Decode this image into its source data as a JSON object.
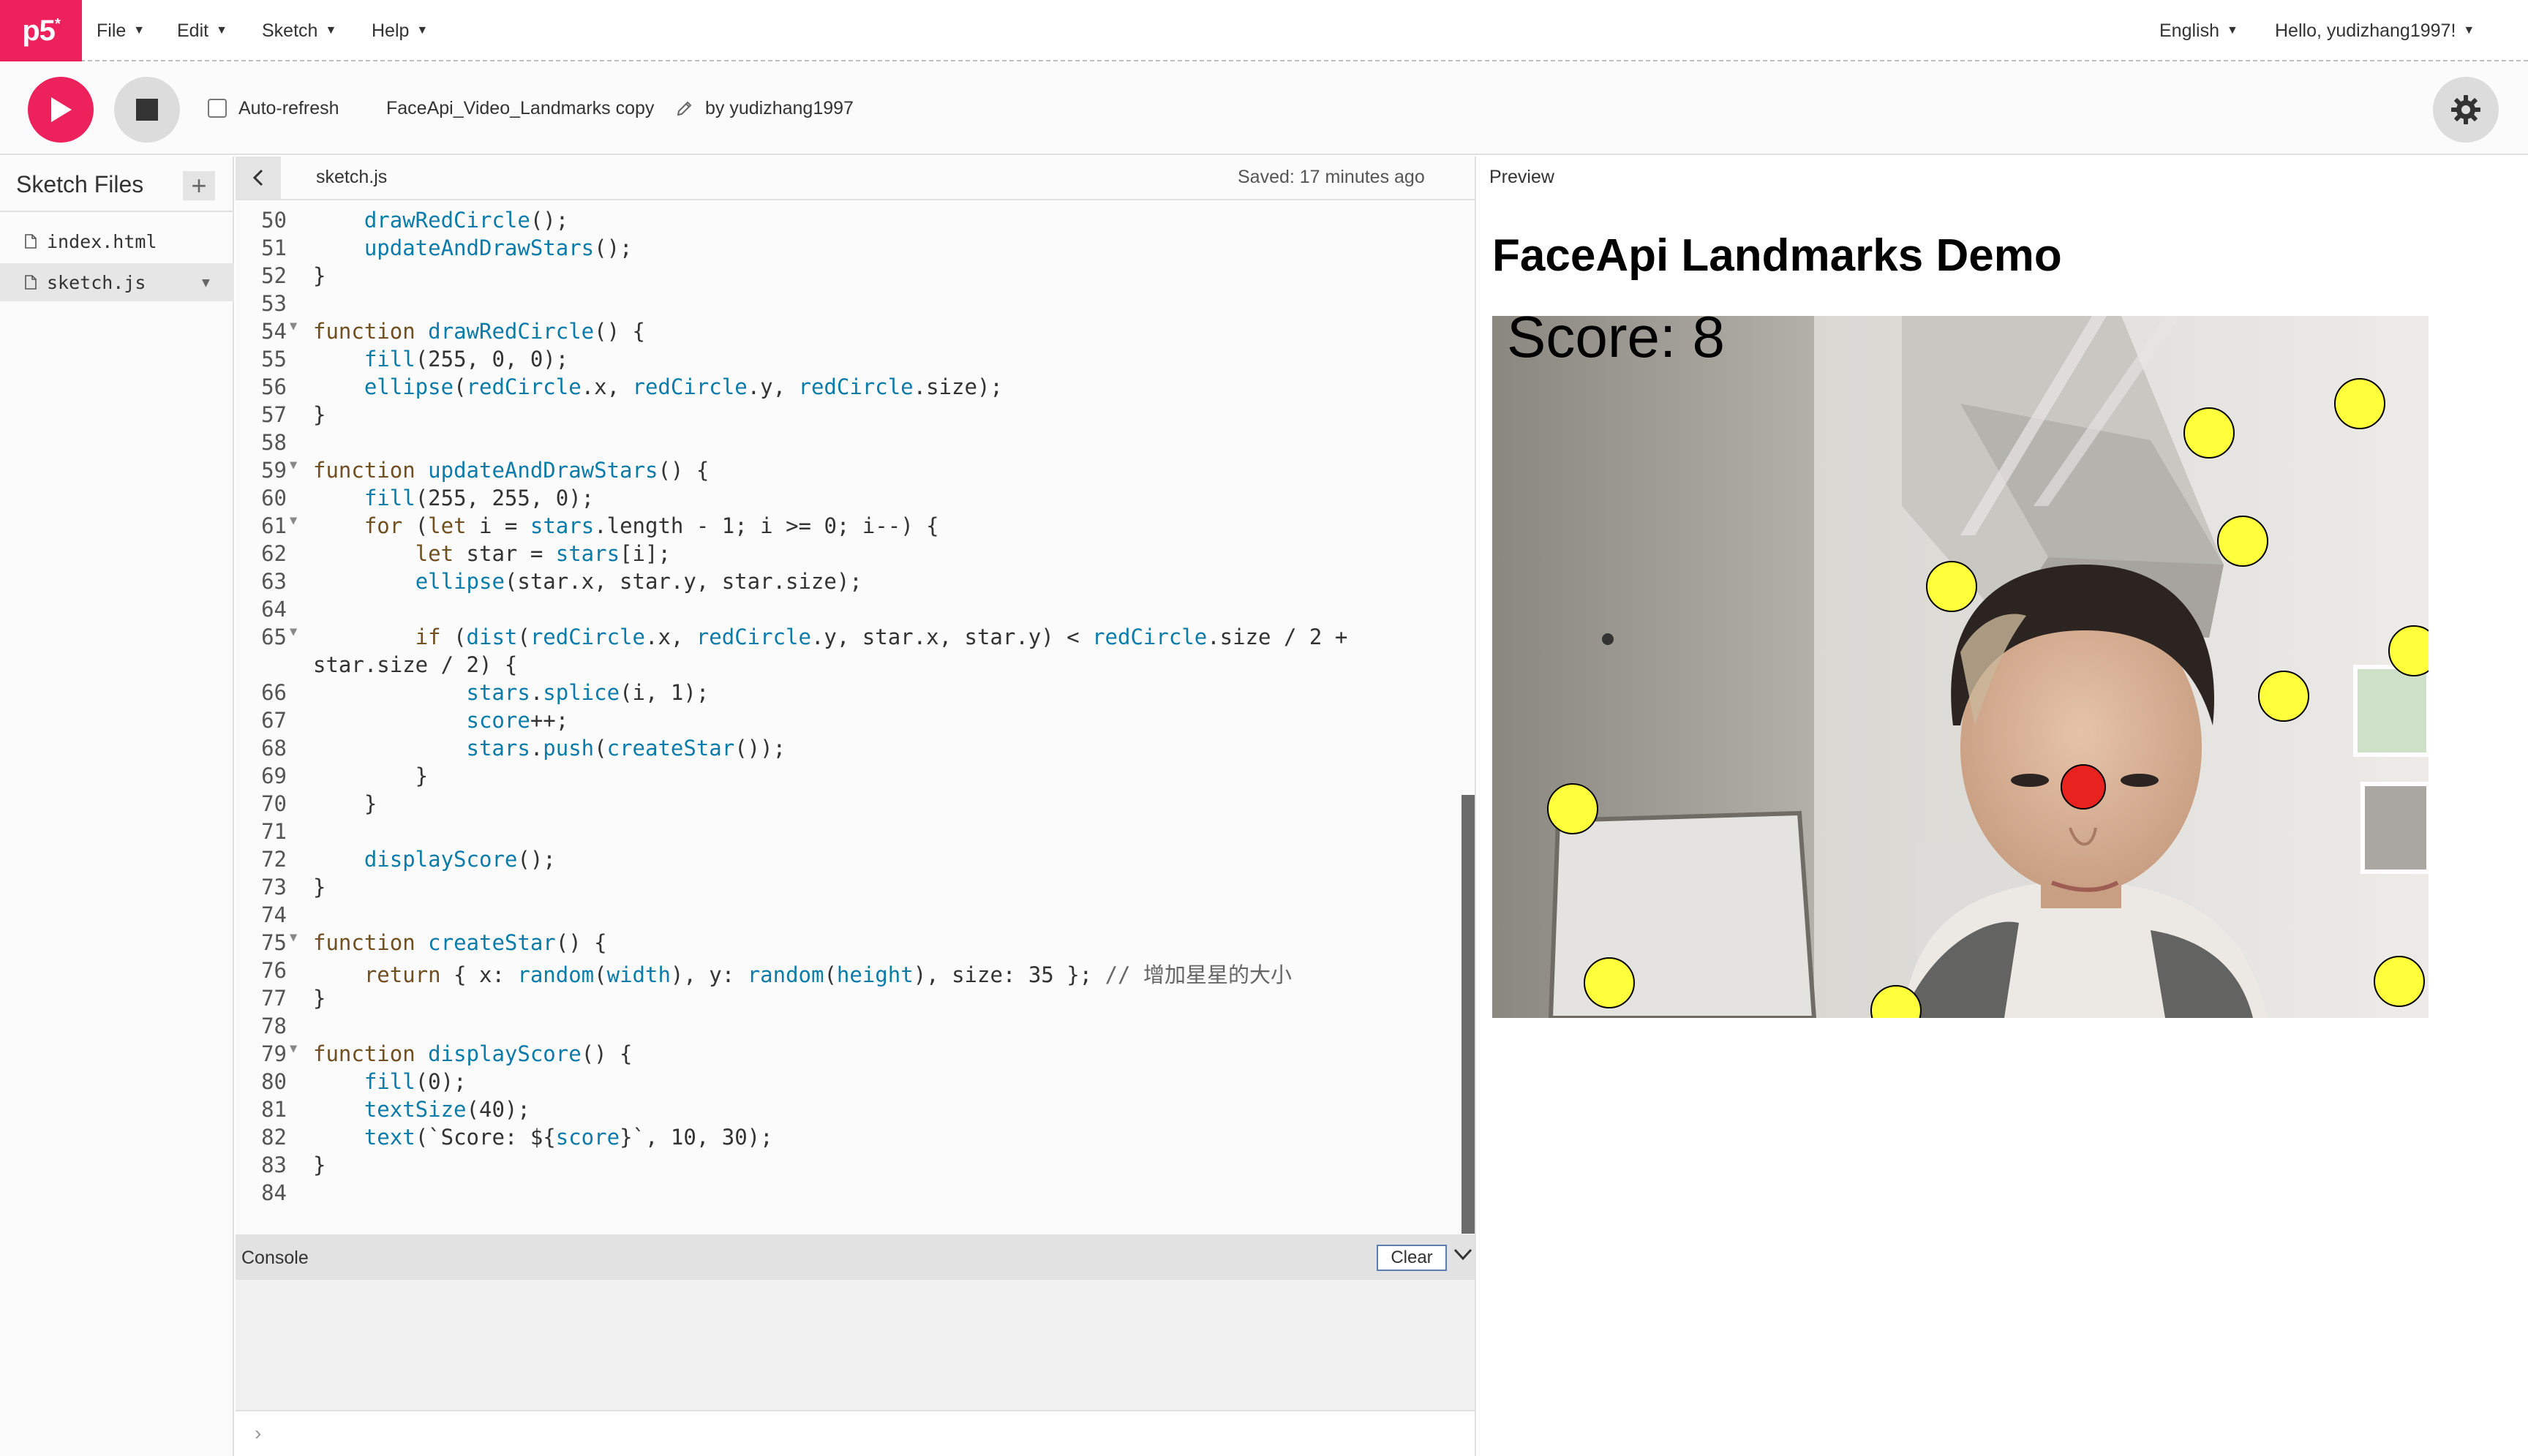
{
  "nav": {
    "logo": "p5",
    "menus": [
      "File",
      "Edit",
      "Sketch",
      "Help"
    ],
    "language": "English",
    "greeting": "Hello, yudizhang1997!"
  },
  "toolbar": {
    "auto_refresh_label": "Auto-refresh",
    "auto_refresh_checked": false,
    "sketch_name": "FaceApi_Video_Landmarks copy",
    "by_label": "by yudizhang1997"
  },
  "sidebar": {
    "title": "Sketch Files",
    "files": [
      "index.html",
      "sketch.js"
    ],
    "selected": "sketch.js"
  },
  "editor": {
    "tab_name": "sketch.js",
    "saved_status": "Saved: 17 minutes ago",
    "lines": [
      {
        "n": "50",
        "text": "    drawRedCircle();",
        "fold": false
      },
      {
        "n": "51",
        "text": "    updateAndDrawStars();",
        "fold": false
      },
      {
        "n": "52",
        "text": "}",
        "fold": false
      },
      {
        "n": "53",
        "text": "",
        "fold": false
      },
      {
        "n": "54",
        "text": "function drawRedCircle() {",
        "fold": true
      },
      {
        "n": "55",
        "text": "    fill(255, 0, 0);",
        "fold": false
      },
      {
        "n": "56",
        "text": "    ellipse(redCircle.x, redCircle.y, redCircle.size);",
        "fold": false
      },
      {
        "n": "57",
        "text": "}",
        "fold": false
      },
      {
        "n": "58",
        "text": "",
        "fold": false
      },
      {
        "n": "59",
        "text": "function updateAndDrawStars() {",
        "fold": true
      },
      {
        "n": "60",
        "text": "    fill(255, 255, 0);",
        "fold": false
      },
      {
        "n": "61",
        "text": "    for (let i = stars.length - 1; i >= 0; i--) {",
        "fold": true
      },
      {
        "n": "62",
        "text": "        let star = stars[i];",
        "fold": false
      },
      {
        "n": "63",
        "text": "        ellipse(star.x, star.y, star.size);",
        "fold": false
      },
      {
        "n": "64",
        "text": "",
        "fold": false
      },
      {
        "n": "65",
        "text": "        if (dist(redCircle.x, redCircle.y, star.x, star.y) < redCircle.size / 2 +",
        "wrap": "star.size / 2) {",
        "fold": true
      },
      {
        "n": "66",
        "text": "            stars.splice(i, 1);",
        "fold": false
      },
      {
        "n": "67",
        "text": "            score++;",
        "fold": false
      },
      {
        "n": "68",
        "text": "            stars.push(createStar());",
        "fold": false
      },
      {
        "n": "69",
        "text": "        }",
        "fold": false
      },
      {
        "n": "70",
        "text": "    }",
        "fold": false
      },
      {
        "n": "71",
        "text": "",
        "fold": false
      },
      {
        "n": "72",
        "text": "    displayScore();",
        "fold": false
      },
      {
        "n": "73",
        "text": "}",
        "fold": false
      },
      {
        "n": "74",
        "text": "",
        "fold": false
      },
      {
        "n": "75",
        "text": "function createStar() {",
        "fold": true
      },
      {
        "n": "76",
        "text": "    return { x: random(width), y: random(height), size: 35 }; // 增加星星的大小",
        "fold": false
      },
      {
        "n": "77",
        "text": "}",
        "fold": false
      },
      {
        "n": "78",
        "text": "",
        "fold": false
      },
      {
        "n": "79",
        "text": "function displayScore() {",
        "fold": true
      },
      {
        "n": "80",
        "text": "    fill(0);",
        "fold": false
      },
      {
        "n": "81",
        "text": "    textSize(40);",
        "fold": false
      },
      {
        "n": "82",
        "text": "    text(`Score: ${score}`, 10, 30);",
        "fold": false
      },
      {
        "n": "83",
        "text": "}",
        "fold": false
      },
      {
        "n": "84",
        "text": "",
        "fold": false
      }
    ]
  },
  "console": {
    "title": "Console",
    "clear_label": "Clear",
    "prompt": "›"
  },
  "preview": {
    "label": "Preview",
    "heading": "FaceApi Landmarks Demo",
    "score_text": "Score: 8"
  },
  "colors": {
    "brand": "#ed225d",
    "star": "#ffff3b",
    "red_circle": "#e8231f",
    "keyword": "#704f21",
    "function_name": "#0b7ca9",
    "number": "#333333",
    "comment": "#666666"
  },
  "icons": [
    "play-icon",
    "stop-icon",
    "pencil-icon",
    "gear-icon",
    "plus-icon",
    "file-icon",
    "chevron-left-icon",
    "chevron-down-icon"
  ]
}
